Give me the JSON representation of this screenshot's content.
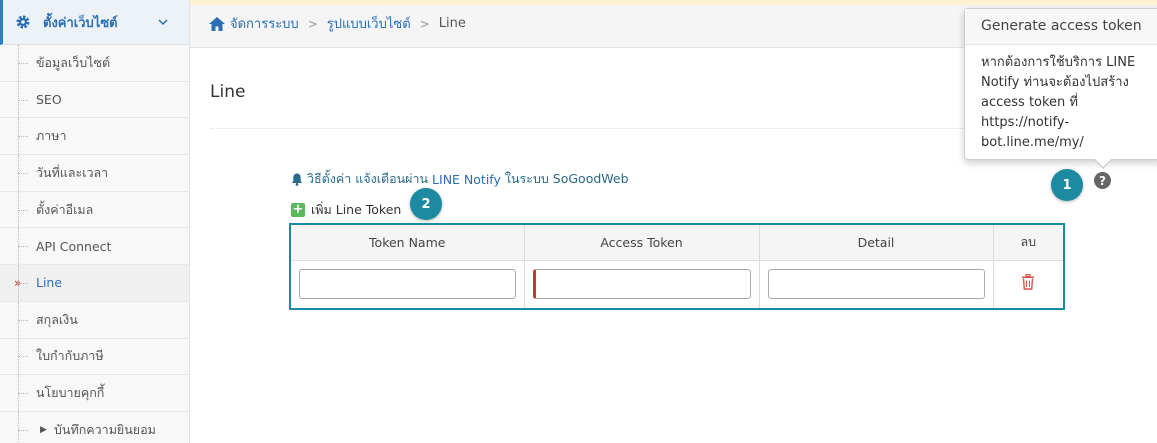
{
  "sidebar": {
    "header": "ตั้งค่าเว็บไซต์",
    "items": [
      {
        "label": "ข้อมูลเว็บไซต์"
      },
      {
        "label": "SEO"
      },
      {
        "label": "ภาษา"
      },
      {
        "label": "วันที่และเวลา"
      },
      {
        "label": "ตั้งค่าอีเมล"
      },
      {
        "label": "API Connect"
      },
      {
        "label": "Line"
      },
      {
        "label": "สกุลเงิน"
      },
      {
        "label": "ใบกำกับภาษี"
      },
      {
        "label": "นโยบายคุกกี้"
      },
      {
        "label": "บันทึกความยินยอม"
      }
    ],
    "active_mark": "»"
  },
  "breadcrumb": {
    "home": "จัดการระบบ",
    "section": "รูปแบบเว็บไซต์",
    "current": "Line",
    "sep": ">"
  },
  "page": {
    "title": "Line"
  },
  "howto": {
    "prefix": "วิธีตั้งค่า แจ้งเตือนผ่าน",
    "keyword": "LINE Notify",
    "suffix": "ในระบบ SoGoodWeb"
  },
  "add_token": {
    "label": "เพิ่ม Line Token",
    "plus": "+"
  },
  "badges": {
    "one": "1",
    "two": "2"
  },
  "help_icon": "?",
  "table": {
    "headers": [
      "Token Name",
      "Access Token",
      "Detail",
      "ลบ"
    ],
    "row": {
      "token_name": "",
      "access_token": "",
      "detail": ""
    }
  },
  "tooltip": {
    "title": "Generate access token",
    "body": "หากต้องการใช้บริการ LINE Notify ท่านจะต้องไปสร้าง access token ที่ https://notify-bot.line.me/my/"
  },
  "colors": {
    "accent_teal": "#1c8aa0",
    "link_blue": "#2b6eb3",
    "danger_red": "#c0392b",
    "success_green": "#5cb85c"
  }
}
